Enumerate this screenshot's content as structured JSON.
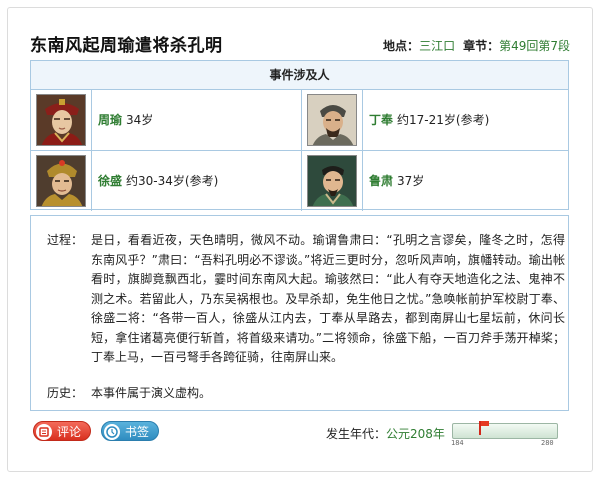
{
  "event": {
    "title": "东南风起周瑜遣将杀孔明",
    "location_label": "地点：",
    "location": "三江口",
    "chapter_label": "章节：",
    "chapter": "第49回第7段"
  },
  "people": {
    "header": "事件涉及人",
    "list": [
      {
        "name": "周瑜",
        "age": "34岁",
        "portrait_icon": "warrior-portrait-icon"
      },
      {
        "name": "丁奉",
        "age": "约17-21岁(参考)",
        "portrait_icon": "elder-portrait-icon"
      },
      {
        "name": "徐盛",
        "age": "约30-34岁(参考)",
        "portrait_icon": "general-portrait-icon"
      },
      {
        "name": "鲁肃",
        "age": "37岁",
        "portrait_icon": "scholar-portrait-icon"
      }
    ]
  },
  "description": {
    "process_label": "过程：",
    "process_text": "是日，看看近夜，天色晴明，微风不动。瑜谓鲁肃曰：“孔明之言谬矣，隆冬之时，怎得东南风乎？”肃曰：“吾料孔明必不谬谈。”将近三更时分，忽听风声响，旗幡转动。瑜出帐看时，旗脚竟飘西北，霎时间东南风大起。瑜骇然曰：“此人有夺天地造化之法、鬼神不测之术。若留此人，乃东吴祸根也。及早杀却，免生他日之忧。”急唤帐前护军校尉丁奉、徐盛二将：“各带一百人，徐盛从江内去，丁奉从旱路去，都到南屏山七星坛前，休问长短，拿住诸葛亮便行斩首，将首级来请功。”二将领命，徐盛下船，一百刀斧手荡开棹桨；丁奉上马，一百弓弩手各跨征骑，往南屏山来。",
    "history_label": "历史：",
    "history_text": "本事件属于演义虚构。"
  },
  "footer": {
    "comment_label": "评论",
    "bookmark_label": "书签",
    "year_label": "发生年代：",
    "year_value": "公元208年",
    "slider_min": "184",
    "slider_max": "280",
    "slider_value": 208,
    "slider_range": [
      184,
      280
    ],
    "accent_color": "#2f7d32"
  }
}
